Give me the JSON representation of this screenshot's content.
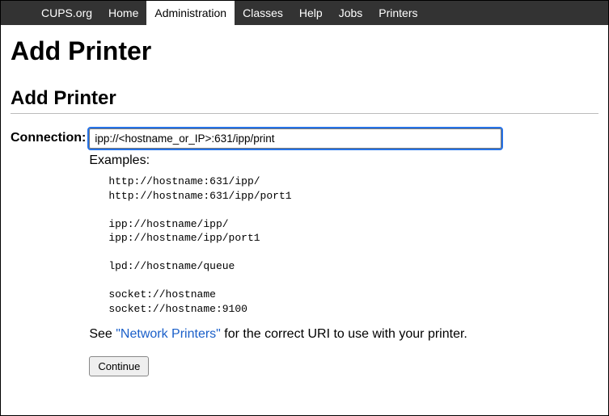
{
  "nav": {
    "items": [
      {
        "label": "CUPS.org",
        "active": false
      },
      {
        "label": "Home",
        "active": false
      },
      {
        "label": "Administration",
        "active": true
      },
      {
        "label": "Classes",
        "active": false
      },
      {
        "label": "Help",
        "active": false
      },
      {
        "label": "Jobs",
        "active": false
      },
      {
        "label": "Printers",
        "active": false
      }
    ]
  },
  "heading_main": "Add Printer",
  "heading_sub": "Add Printer",
  "form": {
    "connection_label": "Connection:",
    "connection_value": "ipp://<hostname_or_IP>:631/ipp/print",
    "examples_label": "Examples:",
    "examples_text": "http://hostname:631/ipp/\nhttp://hostname:631/ipp/port1\n\nipp://hostname/ipp/\nipp://hostname/ipp/port1\n\nlpd://hostname/queue\n\nsocket://hostname\nsocket://hostname:9100",
    "see_prefix": "See ",
    "see_link": "\"Network Printers\"",
    "see_suffix": " for the correct URI to use with your printer.",
    "continue_label": "Continue"
  }
}
